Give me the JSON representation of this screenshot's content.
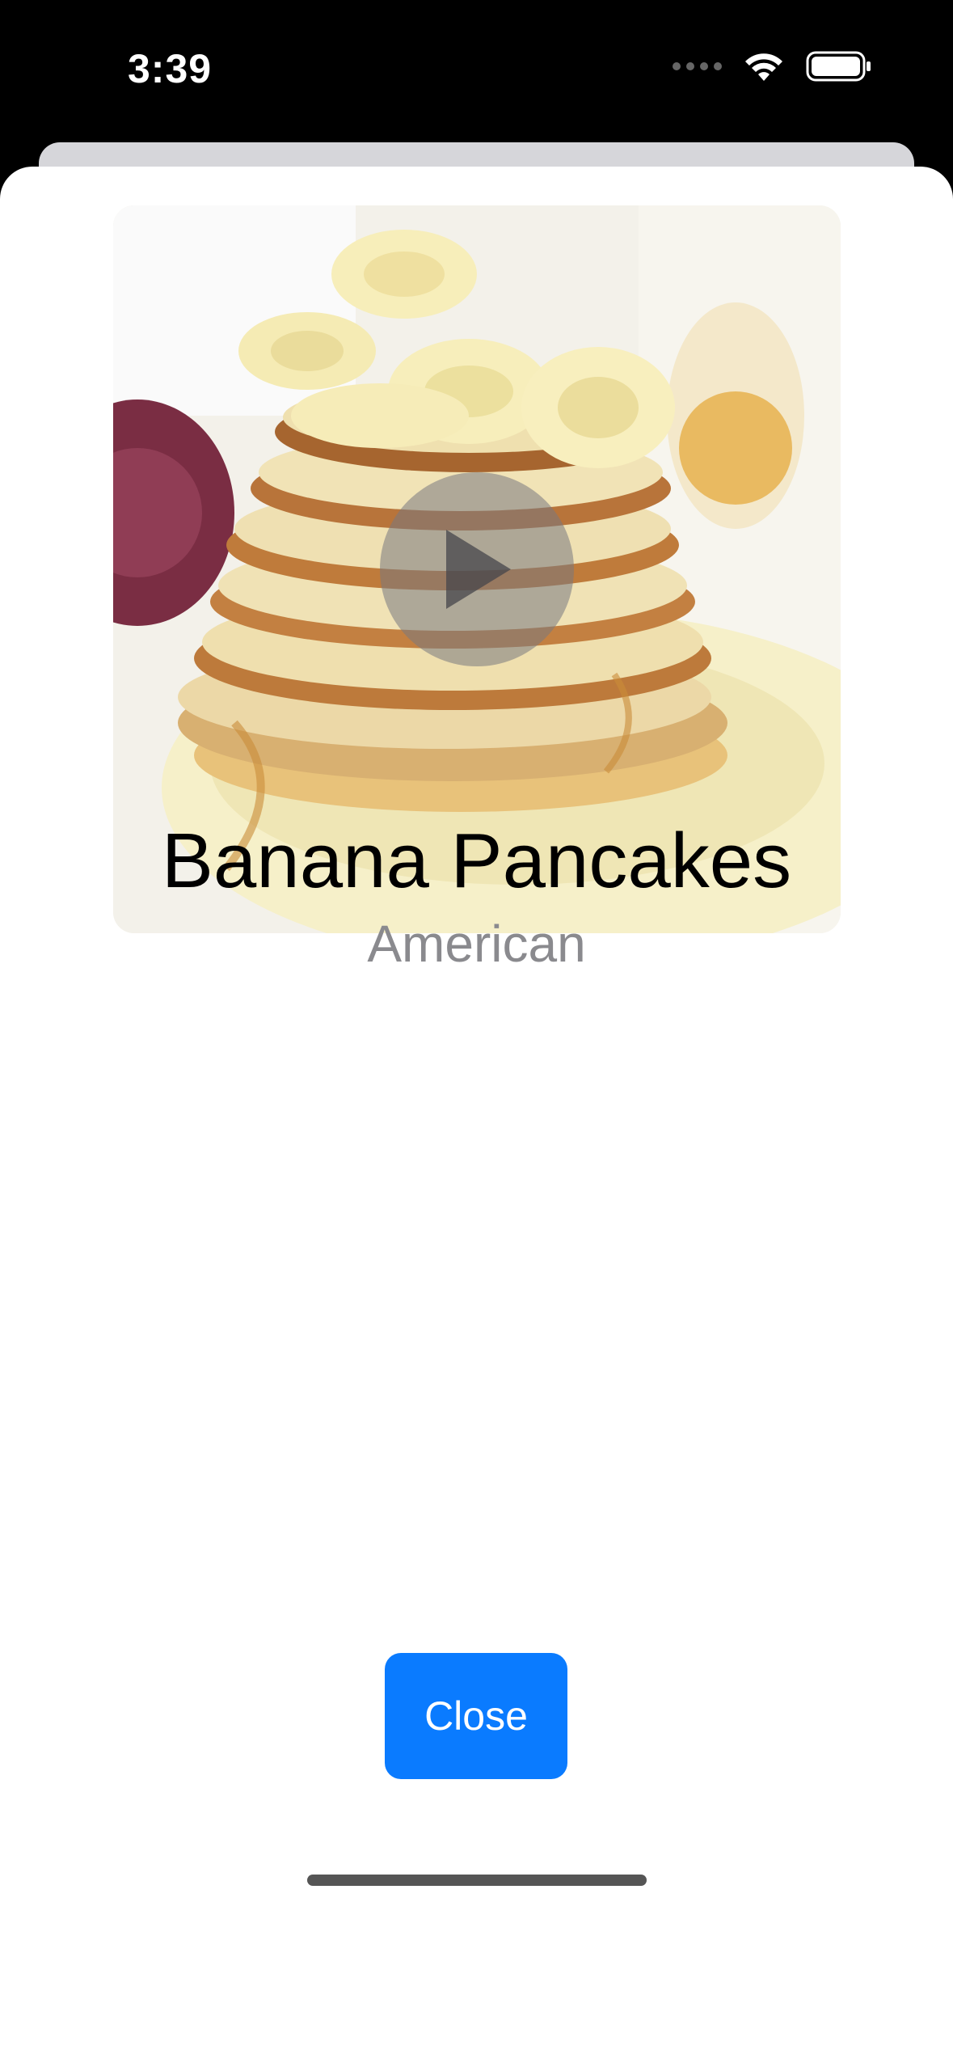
{
  "status_bar": {
    "time": "3:39",
    "icons": [
      "signal-dots-icon",
      "wifi-icon",
      "battery-icon"
    ]
  },
  "recipe": {
    "image_icon": "pancake-photo",
    "play_icon": "play-icon",
    "title": "Banana Pancakes",
    "cuisine": "American"
  },
  "actions": {
    "close_label": "Close"
  },
  "colors": {
    "accent": "#0a7bff",
    "secondary_text": "#8a8a8e"
  }
}
